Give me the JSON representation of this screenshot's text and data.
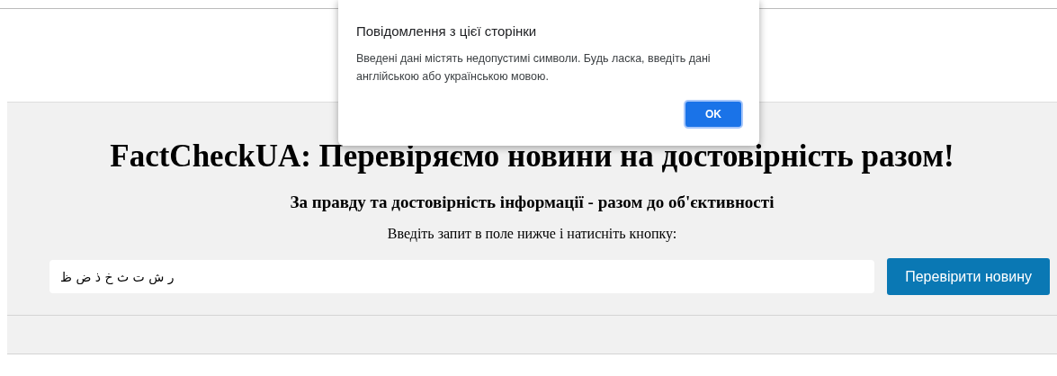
{
  "page": {
    "title": "FactCheckUA: Перевіряємо новини на достовірність разом!",
    "subtitle": "За правду та достовірність інформації - разом до об'єктивності",
    "instruction": "Введіть запит в поле нижче і натисніть кнопку:",
    "search": {
      "value": "ر ش ت ث خ ذ ض ظ"
    },
    "button": "Перевірити новину"
  },
  "dialog": {
    "title": "Повідомлення з цієї сторінки",
    "message": "Введені дані містять недопустимі символи. Будь ласка, введіть дані англійською або українською мовою.",
    "button": "OK"
  }
}
